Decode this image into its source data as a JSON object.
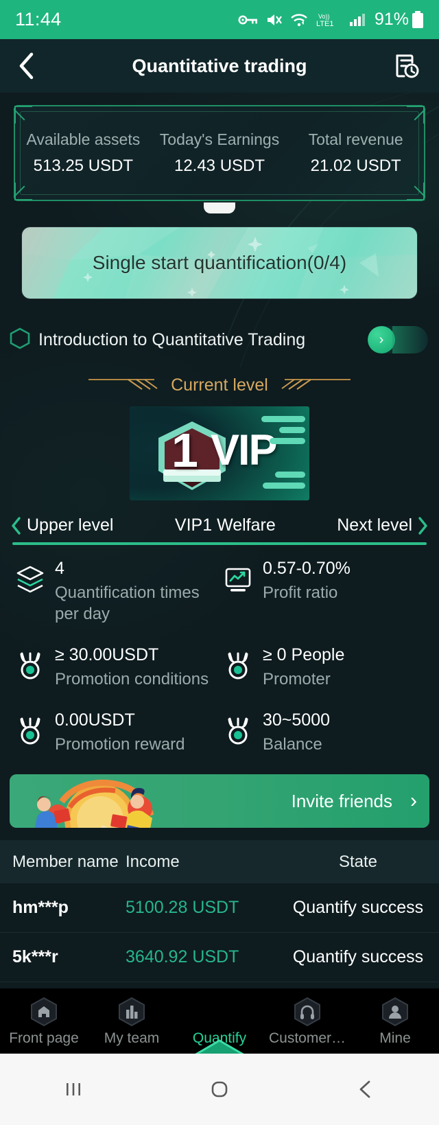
{
  "statusbar": {
    "time": "11:44",
    "battery": "91%",
    "network": "LTE1",
    "volte": "Vo))",
    "icons": [
      "key-icon",
      "mute-icon",
      "wifi-icon",
      "volte-icon",
      "signal-icon",
      "battery-icon"
    ]
  },
  "header": {
    "title": "Quantitative trading",
    "back_icon": "chevron-left-icon",
    "record_icon": "document-clock-icon"
  },
  "assets": {
    "items": [
      {
        "label": "Available assets",
        "value": "513.25 USDT"
      },
      {
        "label": "Today's Earnings",
        "value": "12.43 USDT"
      },
      {
        "label": "Total revenue",
        "value": "21.02 USDT"
      }
    ]
  },
  "quant_banner": {
    "label": "Single start quantification(0/4)"
  },
  "intro": {
    "label": "Introduction to Quantitative Trading",
    "hex_icon": "hexagon-icon",
    "arrow": "›"
  },
  "current_level": {
    "title": "Current level",
    "badge_number": "1",
    "badge_word": "VIP"
  },
  "level_nav": {
    "prev": "Upper level",
    "current": "VIP1 Welfare",
    "next": "Next level",
    "prev_icon": "chevron-left-icon",
    "next_icon": "chevron-right-icon"
  },
  "benefits": [
    {
      "value": "4",
      "label": "Quantification times per day",
      "icon": "layers-icon"
    },
    {
      "value": "0.57-0.70%",
      "label": "Profit ratio",
      "icon": "monitor-chart-icon"
    },
    {
      "value": "≥ 30.00USDT",
      "label": "Promotion conditions",
      "icon": "medal-icon"
    },
    {
      "value": "≥ 0 People",
      "label": "Promoter",
      "icon": "medal-icon"
    },
    {
      "value": "0.00USDT",
      "label": "Promotion reward",
      "icon": "medal-icon"
    },
    {
      "value": "30~5000",
      "label": "Balance",
      "icon": "medal-icon"
    }
  ],
  "invite": {
    "label": "Invite friends",
    "chevron": "›"
  },
  "table": {
    "columns": [
      "Member name",
      "Income",
      "State"
    ],
    "rows": [
      {
        "name": "hm***p",
        "income": "5100.28 USDT",
        "state": "Quantify success"
      },
      {
        "name": "5k***r",
        "income": "3640.92 USDT",
        "state": "Quantify success"
      }
    ]
  },
  "bottom_nav": {
    "items": [
      {
        "label": "Front page",
        "icon": "home-hex-icon",
        "active": false
      },
      {
        "label": "My team",
        "icon": "chart-hex-icon",
        "active": false
      },
      {
        "label": "Quantify",
        "icon": "quantify-hex-icon",
        "active": true
      },
      {
        "label": "Customer…",
        "icon": "headset-hex-icon",
        "active": false
      },
      {
        "label": "Mine",
        "icon": "person-hex-icon",
        "active": false
      }
    ]
  },
  "system_nav": {
    "recents_icon": "recents-icon",
    "home_icon": "home-circle-icon",
    "back_icon": "back-chevron-icon"
  },
  "colors": {
    "accent_green": "#1fb57f",
    "page_bg": "#0e1b1f",
    "card_border": "#1f8f66",
    "gold": "#d6a860",
    "income_green": "#27b68c"
  }
}
